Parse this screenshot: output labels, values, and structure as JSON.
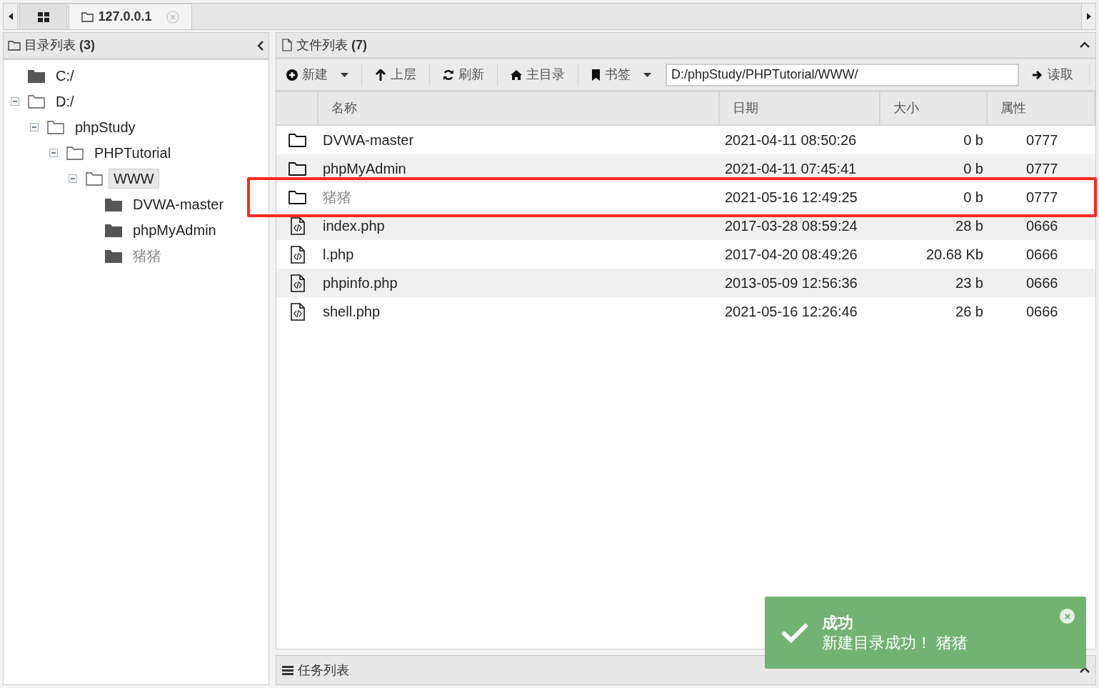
{
  "tabs": [
    {
      "kind": "home",
      "selected": false
    },
    {
      "kind": "host",
      "label": "127.0.0.1",
      "selected": true
    }
  ],
  "tree_panel": {
    "title": "目录列表",
    "count": "(3)"
  },
  "tree": [
    {
      "label": "C:/",
      "expanded": false,
      "selected": false,
      "muted": false
    },
    {
      "label": "D:/",
      "expanded": true,
      "selected": false,
      "muted": false,
      "children": [
        {
          "label": "phpStudy",
          "expanded": true,
          "selected": false,
          "muted": false,
          "children": [
            {
              "label": "PHPTutorial",
              "expanded": true,
              "selected": false,
              "muted": false,
              "children": [
                {
                  "label": "WWW",
                  "expanded": true,
                  "selected": true,
                  "muted": false,
                  "children": [
                    {
                      "label": "DVWA-master",
                      "expanded": false,
                      "selected": false,
                      "muted": false
                    },
                    {
                      "label": "phpMyAdmin",
                      "expanded": false,
                      "selected": false,
                      "muted": false
                    },
                    {
                      "label": "猪猪",
                      "expanded": false,
                      "selected": false,
                      "muted": true
                    }
                  ]
                }
              ]
            }
          ]
        }
      ]
    }
  ],
  "file_panel": {
    "title": "文件列表",
    "count": "(7)"
  },
  "toolbar": [
    {
      "kind": "new",
      "label": "新建",
      "dropdown": true
    },
    {
      "kind": "up",
      "label": "上层",
      "dropdown": false
    },
    {
      "kind": "refresh",
      "label": "刷新",
      "dropdown": false
    },
    {
      "kind": "home",
      "label": "主目录",
      "dropdown": false
    },
    {
      "kind": "bookmark",
      "label": "书签",
      "dropdown": true
    }
  ],
  "path": {
    "value": "D:/phpStudy/PHPTutorial/WWW/",
    "button": "读取"
  },
  "table": {
    "columns": [
      "名称",
      "日期",
      "大小",
      "属性"
    ],
    "rows": [
      {
        "kind": "folder",
        "name": "DVWA-master",
        "date": "2021-04-11 08:50:26",
        "size": "0 b",
        "attr": "0777",
        "muted": false,
        "annotated": false
      },
      {
        "kind": "folder",
        "name": "phpMyAdmin",
        "date": "2021-04-11 07:45:41",
        "size": "0 b",
        "attr": "0777",
        "muted": false,
        "annotated": false
      },
      {
        "kind": "folder",
        "name": "猪猪",
        "date": "2021-05-16 12:49:25",
        "size": "0 b",
        "attr": "0777",
        "muted": true,
        "annotated": true
      },
      {
        "kind": "code",
        "name": "index.php",
        "date": "2017-03-28 08:59:24",
        "size": "28 b",
        "attr": "0666",
        "muted": false,
        "annotated": false
      },
      {
        "kind": "code",
        "name": "l.php",
        "date": "2017-04-20 08:49:26",
        "size": "20.68 Kb",
        "attr": "0666",
        "muted": false,
        "annotated": false
      },
      {
        "kind": "code",
        "name": "phpinfo.php",
        "date": "2013-05-09 12:56:36",
        "size": "23 b",
        "attr": "0666",
        "muted": false,
        "annotated": false
      },
      {
        "kind": "code",
        "name": "shell.php",
        "date": "2021-05-16 12:26:46",
        "size": "26 b",
        "attr": "0666",
        "muted": false,
        "annotated": false
      }
    ]
  },
  "task_panel": {
    "title": "任务列表"
  },
  "toast": {
    "title": "成功",
    "message": "新建目录成功！ 猪猪"
  }
}
